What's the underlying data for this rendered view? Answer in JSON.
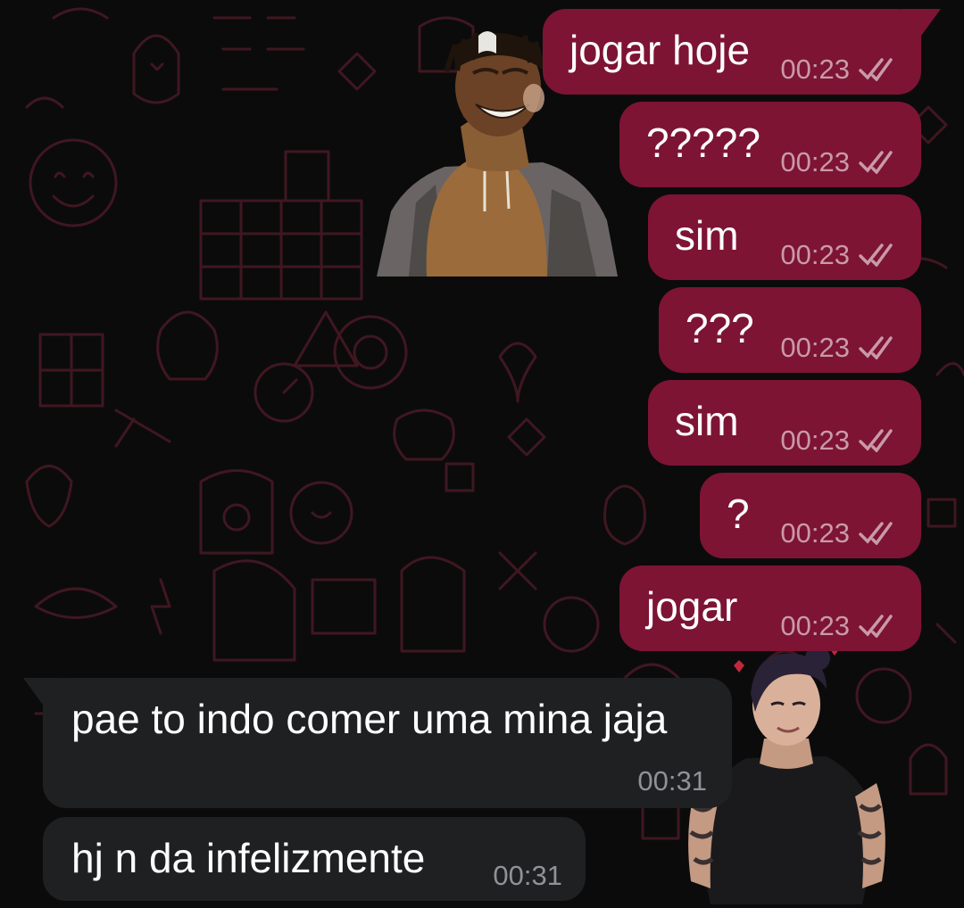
{
  "colors": {
    "outgoing_bubble": "#7d1434",
    "incoming_bubble": "#1f2021",
    "background": "#0b0b0c",
    "wallpaper_doodle": "#5a1f2c",
    "outgoing_meta": "#c99aa7",
    "incoming_meta": "#8d9396"
  },
  "messages": {
    "outgoing": [
      {
        "text": "jogar hoje",
        "time": "00:23",
        "status": "read-double-check-icon"
      },
      {
        "text": "?????",
        "time": "00:23",
        "status": "read-double-check-icon"
      },
      {
        "text": "sim",
        "time": "00:23",
        "status": "read-double-check-icon"
      },
      {
        "text": "???",
        "time": "00:23",
        "status": "read-double-check-icon"
      },
      {
        "text": "sim",
        "time": "00:23",
        "status": "read-double-check-icon"
      },
      {
        "text": "?",
        "time": "00:23",
        "status": "read-double-check-icon"
      },
      {
        "text": "jogar",
        "time": "00:23",
        "status": "read-double-check-icon"
      }
    ],
    "incoming": [
      {
        "text": "pae to indo comer uma mina jaja",
        "time": "00:31"
      },
      {
        "text": "hj n da infelizmente",
        "time": "00:31"
      }
    ]
  },
  "stickers": {
    "top": "laughing-guy-sticker",
    "bottom": "muscular-guy-sticker"
  }
}
